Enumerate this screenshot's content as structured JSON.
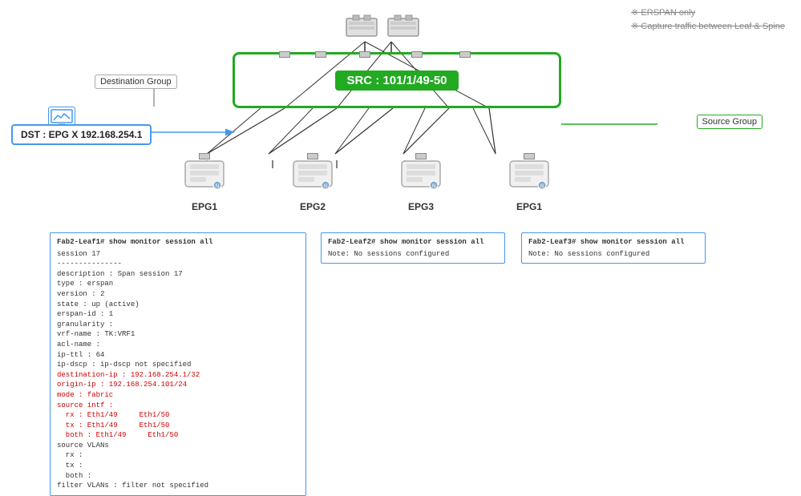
{
  "erspan": {
    "line1": "※ ERSPAN only",
    "line2": "※ Capture traffic between Leaf & Spine"
  },
  "src_box": {
    "label": "SRC : 101/1/49-50"
  },
  "source_group": {
    "label": "Source Group"
  },
  "destination_group": {
    "label": "Destination Group"
  },
  "dst_box": {
    "label": "DST : EPG X 192.168.254.1"
  },
  "epgs": [
    {
      "label": "EPG1"
    },
    {
      "label": "EPG2"
    },
    {
      "label": "EPG3"
    },
    {
      "label": "EPG1"
    }
  ],
  "terminal1": {
    "title": "Fab2-Leaf1# show monitor session all",
    "lines": [
      "session 17",
      "---------------",
      "description    : Span session 17",
      "type           : erspan",
      "version        : 2",
      "state          : up (active)",
      "erspan-id      : 1",
      "granularity    :",
      "vrf-name       : TK:VRF1",
      "acl-name       :",
      "ip-ttl         : 64",
      "ip-dscp        : ip-dscp not specified",
      "destination-ip : 192.168.254.1/32",
      "origin-ip      : 192.168.254.101/24",
      "mode           : fabric",
      "source intf    :",
      "  rx           : Eth1/49     Eth1/50",
      "  tx           : Eth1/49     Eth1/50",
      "  both         : Eth1/49     Eth1/50",
      "source VLANs",
      "  rx           :",
      "  tx           :",
      "  both         :",
      "filter VLANs   : filter not specified"
    ],
    "red_lines": [
      13,
      14,
      15,
      16,
      17,
      18
    ]
  },
  "terminal2": {
    "title": "Fab2-Leaf2# show monitor session all",
    "note": "Note: No sessions configured"
  },
  "terminal3": {
    "title": "Fab2-Leaf3# show monitor session all",
    "note": "Note: No sessions configured"
  }
}
